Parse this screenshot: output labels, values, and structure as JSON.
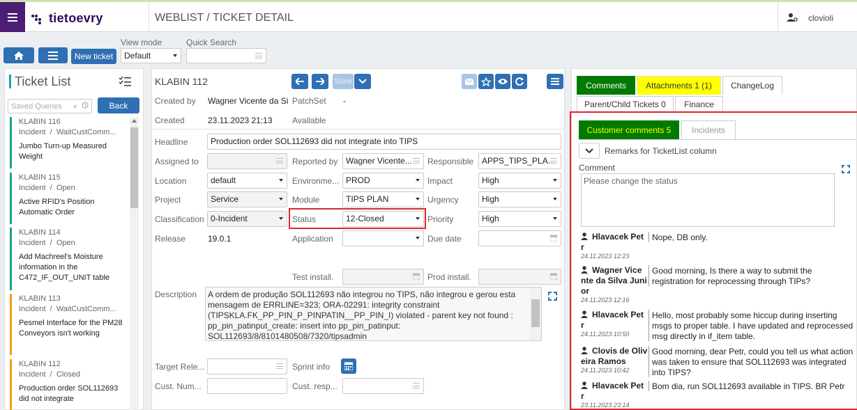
{
  "header": {
    "logo_text": "tietoevry",
    "page_title": "WEBLIST / TICKET DETAIL",
    "username": "clovioli"
  },
  "toolbar": {
    "new_ticket_label": "New ticket",
    "view_mode_label": "View mode",
    "view_mode_value": "Default",
    "quick_search_label": "Quick Search",
    "quick_search_value": ""
  },
  "ticket_list": {
    "title": "Ticket List",
    "saved_queries_placeholder": "Saved Queries",
    "back_label": "Back",
    "items": [
      {
        "id": "KLABIN 116",
        "type": "Incident",
        "status": "WaitCustComm...",
        "desc": "Jumbo Turn-up Measured Weight",
        "color": "#17a589"
      },
      {
        "id": "KLABIN 115",
        "type": "Incident",
        "status": "Open",
        "desc": "Active RFID's Position Automatic Order",
        "color": "#17a589"
      },
      {
        "id": "KLABIN 114",
        "type": "Incident",
        "status": "Open",
        "desc": "Add Machreel's Moisture information in the C472_IF_OUT_UNIT table",
        "color": "#17a589"
      },
      {
        "id": "KLABIN 113",
        "type": "Incident",
        "status": "WaitCustComm...",
        "desc": "Pesmel Interface for the PM28 Conveyors isn't working",
        "color": "#f39c12"
      },
      {
        "id": "KLABIN 112",
        "type": "Incident",
        "status": "Closed",
        "desc": "Production order SOL112693 did not integrate",
        "color": "#f39c12"
      }
    ]
  },
  "ticket": {
    "title": "KLABIN 112",
    "save_label": "Save",
    "created_by_label": "Created by",
    "created_by": "Wagner Vicente da Silva",
    "patchset_label": "PatchSet",
    "patchset": "-",
    "created_label": "Created",
    "created": "23.11.2023 21:13",
    "available": "Available",
    "headline_label": "Headline",
    "headline": "Production order SOL112693 did not integrate into TIPS",
    "assigned_to_label": "Assigned to",
    "assigned_to": "",
    "reported_by_label": "Reported by",
    "reported_by": "Wagner Vicente...",
    "responsible_label": "Responsible",
    "responsible": "APPS_TIPS_PLA...",
    "location_label": "Location",
    "location": "default",
    "environment_label": "Environme...",
    "environment": "PROD",
    "impact_label": "Impact",
    "impact": "High",
    "project_label": "Project",
    "project": "Service",
    "module_label": "Module",
    "module": "TIPS PLAN",
    "urgency_label": "Urgency",
    "urgency": "High",
    "classification_label": "Classification",
    "classification": "0-Incident",
    "status_label": "Status",
    "status": "12-Closed",
    "priority_label": "Priority",
    "priority": "High",
    "release_label": "Release",
    "release": "19.0.1",
    "application_label": "Application",
    "application": "",
    "due_date_label": "Due date",
    "due_date": "",
    "test_install_label": "Test install.",
    "prod_install_label": "Prod install.",
    "description_label": "Description",
    "description": "A ordem de produção SOL112693 não integrou no TIPS, não integrou e gerou esta mensagem de  ERRLINE=323; ORA-02291: integrity constraint (TIPSKLA.FK_PP_PIN_P_PINPATIN__PP_PIN_I) violated - parent key not found : pp_pin_patinput_create: insert into pp_pin_patinput: SOL112693/8/8101480508/7320/tipsadmin",
    "target_release_label": "Target Rele...",
    "sprint_info_label": "Sprint info",
    "cust_num_label": "Cust. Num...",
    "cust_resp_label": "Cust. resp..."
  },
  "right": {
    "tabs": {
      "comments": "Comments",
      "attachments": "Attachments 1 (1)",
      "changelog": "ChangeLog",
      "parent_child": "Parent/Child Tickets 0",
      "finance": "Finance"
    },
    "subtabs": {
      "customer_comments": "Customer comments 5",
      "incidents": "Incidents"
    },
    "remarks_label": "Remarks for TicketList column",
    "comment_label": "Comment",
    "comment_value": "Please change the status",
    "comments": [
      {
        "author": "Hlavacek Pet r",
        "date": "24.11.2023 12:23",
        "text": "Nope, DB only."
      },
      {
        "author": "Wagner Vice nte da Silva Juni or",
        "date": "24.11.2023 12:16",
        "text": "Good morning, Is there a way to submit the registration for reprocessing through TIPs?"
      },
      {
        "author": "Hlavacek Pet r",
        "date": "24.11.2023 10:50",
        "text": "Hello, most probably some hiccup during inserting msgs to proper table. I have updated and reprocessed msg directly in if_item table."
      },
      {
        "author": "Clovis de Oliv eira Ramos",
        "date": "24.11.2023 10:42",
        "text": "Good morning, dear Petr, could you tell us what action was taken to ensure that SOL112693 was integrated into TIPS?"
      },
      {
        "author": "Hlavacek Pet r",
        "date": "23.11.2023 23:14",
        "text": "Bom dia, run SOL112693 available in TIPS. BR Petr"
      }
    ]
  }
}
